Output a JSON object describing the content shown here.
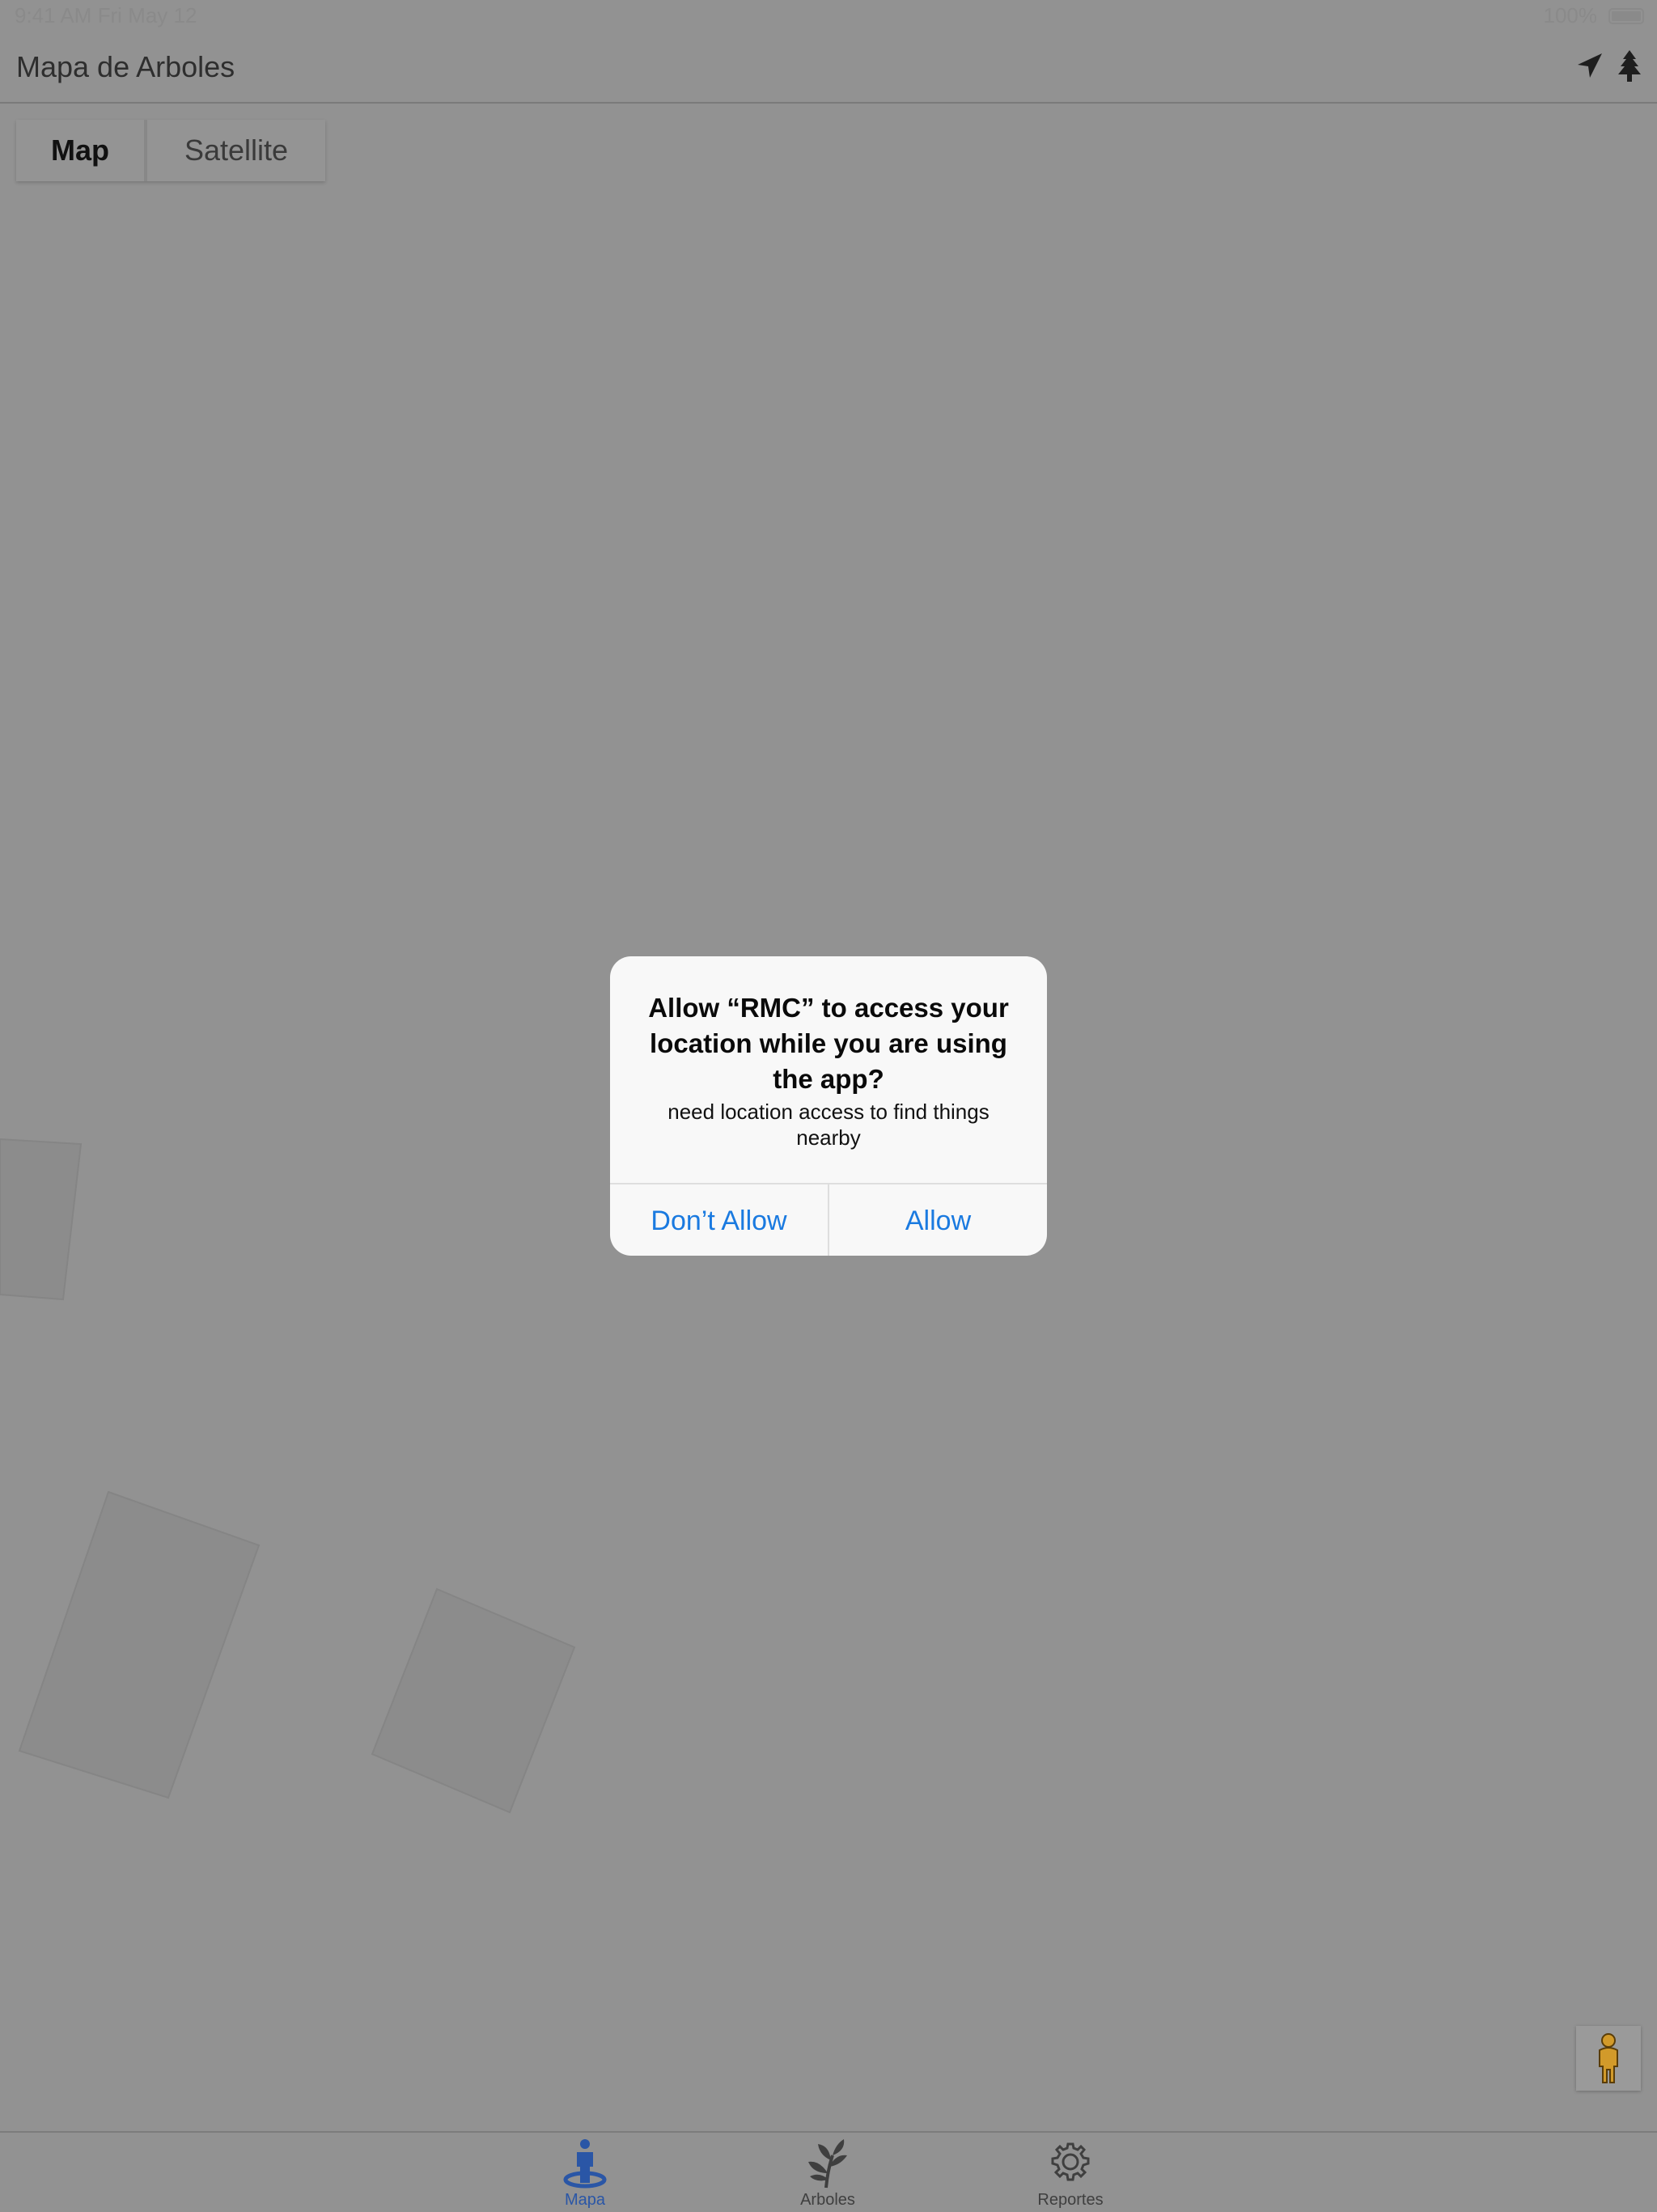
{
  "status_bar": {
    "left_text": "9:41 AM  Fri May 12",
    "right_text": "100%"
  },
  "nav": {
    "title": "Mapa de Arboles",
    "actions": [
      "location-arrow-icon",
      "tree-icon"
    ]
  },
  "map_type": {
    "map_label": "Map",
    "satellite_label": "Satellite",
    "selected": "Map"
  },
  "alert": {
    "title": "Allow “RMC” to access your location while you are using the app?",
    "message": "need location access to find things nearby",
    "dont_allow_label": "Don’t Allow",
    "allow_label": "Allow"
  },
  "tabs": [
    {
      "label": "Mapa",
      "icon": "person-location-icon",
      "active": true
    },
    {
      "label": "Arboles",
      "icon": "plant-icon",
      "active": false
    },
    {
      "label": "Reportes",
      "icon": "gear-icon",
      "active": false
    }
  ],
  "colors": {
    "overlay_bg": "#929292",
    "alert_bg": "#f8f8f8",
    "accent_blue": "#1a7ae0",
    "tab_active": "#2a56a6"
  }
}
